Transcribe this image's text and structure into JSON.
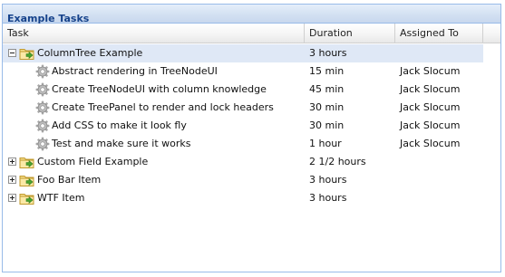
{
  "panel": {
    "title": "Example Tasks"
  },
  "columns": {
    "task": "Task",
    "duration": "Duration",
    "assigned": "Assigned To"
  },
  "tree": {
    "rows": [
      {
        "task": "ColumnTree Example",
        "duration": "3 hours",
        "assigned": "",
        "kind": "folder",
        "state": "expanded",
        "selected": true
      },
      {
        "task": "Abstract rendering in TreeNodeUI",
        "duration": "15 min",
        "assigned": "Jack Slocum",
        "kind": "leaf"
      },
      {
        "task": "Create TreeNodeUI with column knowledge",
        "duration": "45 min",
        "assigned": "Jack Slocum",
        "kind": "leaf"
      },
      {
        "task": "Create TreePanel to render and lock headers",
        "duration": "30 min",
        "assigned": "Jack Slocum",
        "kind": "leaf"
      },
      {
        "task": "Add CSS to make it look fly",
        "duration": "30 min",
        "assigned": "Jack Slocum",
        "kind": "leaf"
      },
      {
        "task": "Test and make sure it works",
        "duration": "1 hour",
        "assigned": "Jack Slocum",
        "kind": "leaf"
      },
      {
        "task": "Custom Field Example",
        "duration": "2 1/2 hours",
        "assigned": "",
        "kind": "folder",
        "state": "collapsed"
      },
      {
        "task": "Foo Bar Item",
        "duration": "3 hours",
        "assigned": "",
        "kind": "folder",
        "state": "collapsed"
      },
      {
        "task": "WTF Item",
        "duration": "3 hours",
        "assigned": "",
        "kind": "folder",
        "state": "collapsed"
      }
    ]
  },
  "colors": {
    "header_title": "#15428b",
    "panel_border": "#99bbe8",
    "selected_row": "#dfe8f6"
  },
  "icons": {
    "folder": "folder-arrow-icon",
    "leaf": "gear-icon",
    "expanded": "minus-toggle-icon",
    "collapsed": "plus-toggle-icon"
  }
}
